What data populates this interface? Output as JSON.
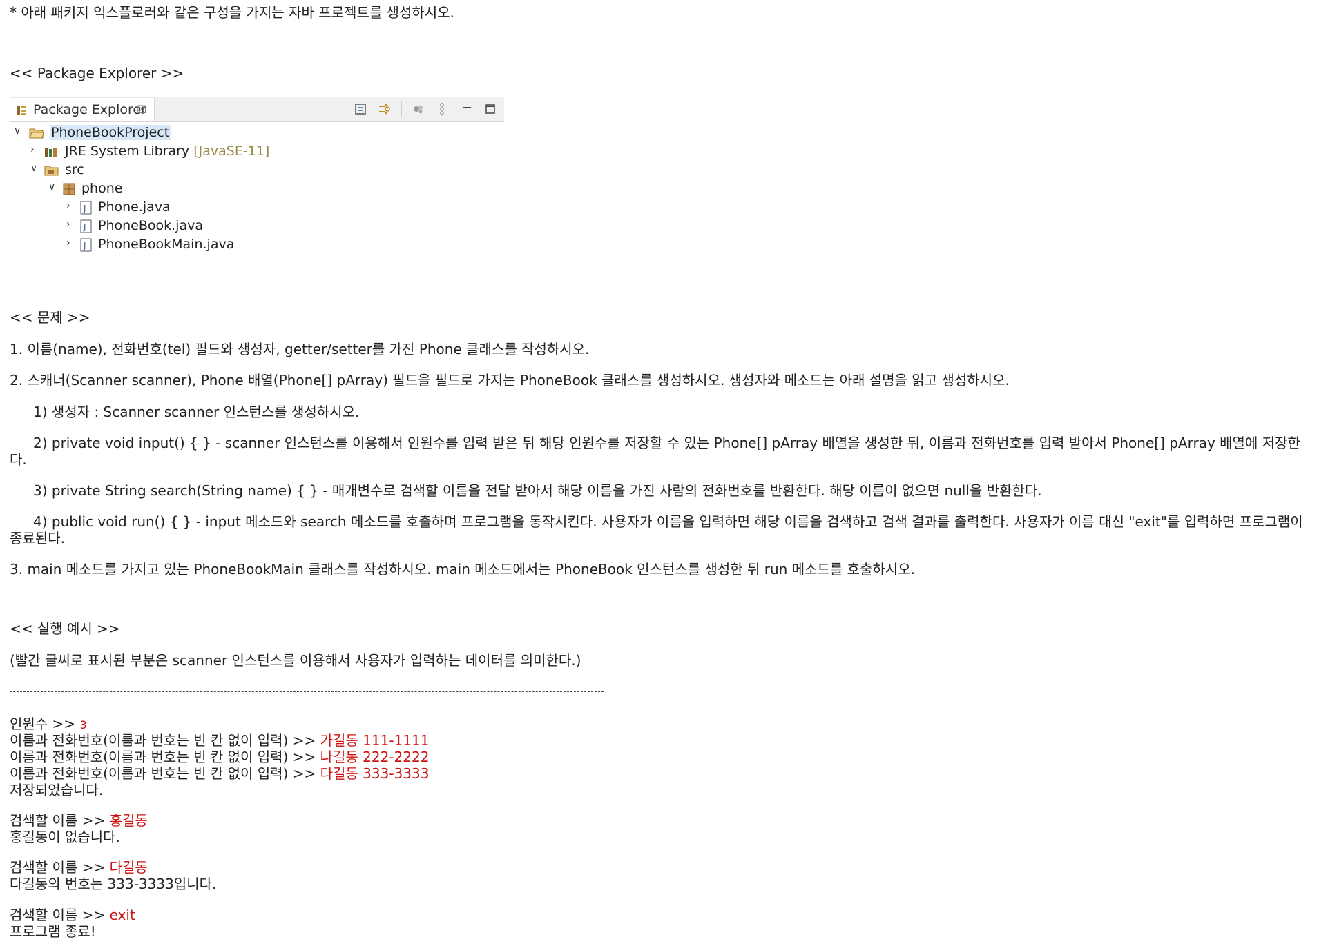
{
  "intro": "* 아래 패키지 익스플로러와 같은 구성을 가지는 자바 프로젝트를 생성하시오.",
  "pe_heading": "<< Package Explorer >>",
  "explorer": {
    "tab_label": "Package Explorer",
    "tab_close": "☒",
    "project": "PhoneBookProject",
    "jre_label": "JRE System Library",
    "jre_decoration": "[JavaSE-11]",
    "src": "src",
    "package": "phone",
    "files": [
      "Phone.java",
      "PhoneBook.java",
      "PhoneBookMain.java"
    ]
  },
  "problem_heading": "<< 문제 >>",
  "problems": {
    "p1": "1. 이름(name), 전화번호(tel) 필드와 생성자, getter/setter를 가진 Phone 클래스를 작성하시오.",
    "p2": "2. 스캐너(Scanner scanner), Phone 배열(Phone[] pArray) 필드을 필드로 가지는 PhoneBook 클래스를 생성하시오. 생성자와 메소드는 아래 설명을 읽고 생성하시오.",
    "p2_1": "1) 생성자 : Scanner scanner 인스턴스를 생성하시오.",
    "p2_2": "2) private void input() { } - scanner 인스턴스를 이용해서 인원수를 입력 받은 뒤 해당 인원수를 저장할 수 있는  Phone[] pArray 배열을 생성한 뒤, 이름과 전화번호를 입력 받아서 Phone[] pArray 배열에 저장한다.",
    "p2_3": "3) private String search(String name) { } - 매개변수로 검색할 이름을 전달 받아서 해당 이름을 가진 사람의 전화번호를 반환한다. 해당 이름이 없으면 null을 반환한다.",
    "p2_4": "4) public void run() { } - input 메소드와 search 메소드를 호출하며 프로그램을 동작시킨다. 사용자가 이름을 입력하면 해당 이름을 검색하고 검색 결과를 출력한다. 사용자가 이름 대신 \"exit\"를 입력하면 프로그램이 종료된다.",
    "p3": "3. main 메소드를 가지고 있는 PhoneBookMain 클래스를 작성하시오. main 메소드에서는 PhoneBook 인스턴스를 생성한 뒤 run 메소드를 호출하시오."
  },
  "example_heading": "<< 실행 예시 >>",
  "example_note": "(빨간 글씨로 표시된 부분은 scanner 인스턴스를 이용해서 사용자가 입력하는 데이터를 의미한다.)",
  "console": {
    "count_prompt": "인원수 >> ",
    "count_input": "3",
    "entry_prompt": "이름과 전화번호(이름과 번호는 빈 칸 없이 입력) >> ",
    "entries": [
      "가길동 111-1111",
      "나길동 222-2222",
      "다길동 333-3333"
    ],
    "saved": "저장되었습니다.",
    "search_prompt": "검색할 이름 >> ",
    "search1_input": "홍길동",
    "search1_result": "홍길동이 없습니다.",
    "search2_input": "다길동",
    "search2_result": "다길동의 번호는 333-3333입니다.",
    "search3_input": "exit",
    "end": "프로그램 종료!"
  },
  "colors": {
    "input_red": "#cc1111",
    "selection": "#d8e8f8"
  }
}
